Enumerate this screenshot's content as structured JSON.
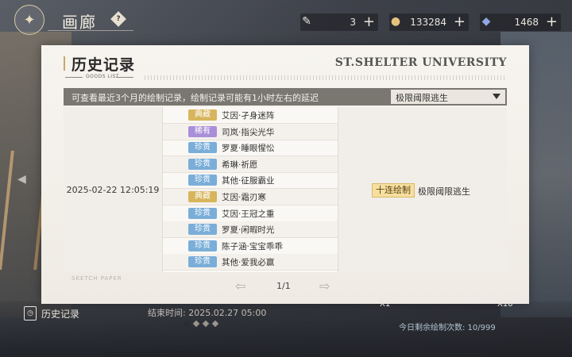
{
  "topbar": {
    "gallery_title": "画廊",
    "help_glyph": "?",
    "currencies": [
      {
        "icon": "brush-icon",
        "value": "3"
      },
      {
        "icon": "coin-icon",
        "value": "133284"
      },
      {
        "icon": "crystal-icon",
        "value": "1468"
      }
    ],
    "plus": "+"
  },
  "modal": {
    "title": "历史记录",
    "subtitle": "GOODS LIST",
    "university": "ST.SHELTER UNIVERSITY",
    "info": "可查看最近3个月的绘制记录，绘制记录可能有1小时左右的延迟",
    "filter_selected": "极限阈限逃生",
    "record": {
      "time": "2025-02-22  12:05:19",
      "items": [
        {
          "rarity": "典藏",
          "tier": "gold",
          "name": "艾因·孑身迷阵"
        },
        {
          "rarity": "稀有",
          "tier": "purple",
          "name": "司岚·指尖光华"
        },
        {
          "rarity": "珍贵",
          "tier": "blue",
          "name": "罗夏·睡眼惺忪"
        },
        {
          "rarity": "珍贵",
          "tier": "blue",
          "name": "希琳·祈愿"
        },
        {
          "rarity": "珍贵",
          "tier": "blue",
          "name": "其他·征服霸业"
        },
        {
          "rarity": "典藏",
          "tier": "gold",
          "name": "艾因·霜刃寒"
        },
        {
          "rarity": "珍贵",
          "tier": "blue",
          "name": "艾因·王冠之重"
        },
        {
          "rarity": "珍贵",
          "tier": "blue",
          "name": "罗夏·闲暇时光"
        },
        {
          "rarity": "珍贵",
          "tier": "blue",
          "name": "陈子涵·宝宝乖乖"
        },
        {
          "rarity": "珍贵",
          "tier": "blue",
          "name": "其他·爱我必赢"
        }
      ],
      "type_tag": "十连绘制",
      "type_name": "极限阈限逃生"
    },
    "sketch_label": "SKETCH PAPER",
    "pager": "1/1"
  },
  "bottom": {
    "history_label": "历史记录",
    "end_time": "结束时间: 2025.02.27 05:00",
    "x1": "X1",
    "x10": "X10",
    "daily": "今日剩余绘制次数: 10/999"
  },
  "colors": {
    "gold": "#d7b55c",
    "purple": "#a98fd8",
    "blue": "#7aaed8",
    "info_bar": "#7a7670"
  }
}
